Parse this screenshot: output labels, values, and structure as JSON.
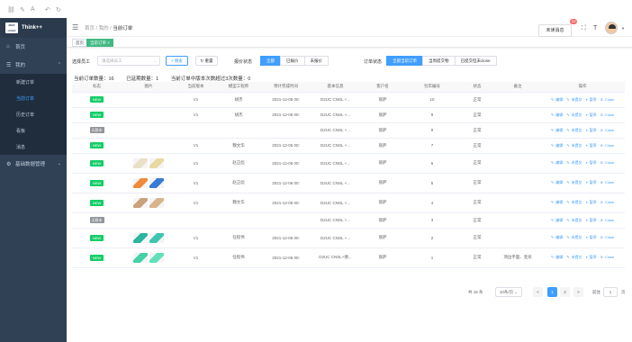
{
  "topbar_tools": [
    "⌀",
    "⌀",
    "⎌",
    "↻",
    "⚐"
  ],
  "sidebar": {
    "logo_mark": "MGR LOGO",
    "app_name": "Think++",
    "items": [
      {
        "label": "首页",
        "icon": "home-icon"
      },
      {
        "label": "我的",
        "icon": "user-icon",
        "expanded": true
      },
      {
        "label": "新建订单",
        "sub": true
      },
      {
        "label": "当前订单",
        "sub": true,
        "active": true
      },
      {
        "label": "历史订单",
        "sub": true
      },
      {
        "label": "看板",
        "sub": true
      },
      {
        "label": "消息",
        "sub": true
      },
      {
        "label": "基础数据管理",
        "icon": "gear-icon"
      }
    ]
  },
  "header": {
    "breadcrumb": [
      "首页",
      "我的",
      "当前订单"
    ],
    "msg_button": "未读消息",
    "msg_count": "20"
  },
  "tags": [
    "首页",
    "当前订单 ×"
  ],
  "filters": {
    "employee_label": "选择员工",
    "employee_placeholder": "请选择员工",
    "search_btn": "搜索",
    "reset_btn": "重置",
    "quote_label": "报价状态",
    "quote_options": [
      "全部",
      "已报价",
      "未报价"
    ],
    "order_label": "订单状态",
    "order_options": [
      "全部当前订单",
      "当周提交物",
      "已提交但未close"
    ]
  },
  "stats": {
    "current": "当前订单数量：16",
    "overdue": "已延期数量：1",
    "revised": "当前订单中版本次数超过3次数量：0"
  },
  "table": {
    "headers": [
      "标志",
      "图片",
      "当前版本",
      "模型工程师",
      "预计完成时间",
      "基本信息",
      "客户名",
      "包年编号",
      "状态",
      "备注",
      "操作"
    ],
    "rows": [
      {
        "flag": "NEW",
        "img": [],
        "ver": "V1",
        "eng": "胡杰",
        "date": "2021-12-06 00:",
        "info": "D2UC CNSL +...",
        "cust": "丽萨",
        "no": "10",
        "status": "正常",
        "note": ""
      },
      {
        "flag": "NEW",
        "img": [],
        "ver": "V1",
        "eng": "胡杰",
        "date": "2021-12-06 00:",
        "info": "D2UC CNSL +...",
        "cust": "丽萨",
        "no": "9",
        "status": "正常",
        "note": ""
      },
      {
        "flag": "无版本",
        "img": [],
        "ver": "",
        "eng": "",
        "date": "",
        "info": "D2UC CNSL +...",
        "cust": "丽萨",
        "no": "8",
        "status": "正常",
        "note": ""
      },
      {
        "flag": "NEW",
        "img": [],
        "ver": "V1",
        "eng": "魏文华",
        "date": "2021-12-06 00:",
        "info": "D2UC CNSL +...",
        "cust": "丽萨",
        "no": "7",
        "status": "正常",
        "note": ""
      },
      {
        "flag": "NEW",
        "img": [
          "#e8e1c6",
          "#e8d9a0"
        ],
        "ver": "V1",
        "eng": "赵正彪",
        "date": "2021-12-06 00:",
        "info": "D2UC CNSL +...",
        "cust": "丽萨",
        "no": "6",
        "status": "正常",
        "note": ""
      },
      {
        "flag": "NEW",
        "img": [
          "#f08a3c",
          "#3a7bd5"
        ],
        "ver": "V1",
        "eng": "赵正彪",
        "date": "2021-12-06 00:",
        "info": "D2UC CNSL +...",
        "cust": "丽萨",
        "no": "5",
        "status": "正常",
        "note": ""
      },
      {
        "flag": "NEW",
        "img": [
          "#c9a27a",
          "#d8b48c"
        ],
        "ver": "V1",
        "eng": "魏文华",
        "date": "2021-12-06 00:",
        "info": "D2UC CNSL +...",
        "cust": "丽萨",
        "no": "4",
        "status": "正常",
        "note": ""
      },
      {
        "flag": "无版本",
        "img": [],
        "ver": "",
        "eng": "",
        "date": "",
        "info": "D2UC CNSL +...",
        "cust": "丽萨",
        "no": "3",
        "status": "正常",
        "note": ""
      },
      {
        "flag": "NEW",
        "img": [
          "#2bb5a0",
          "#3fc6b0"
        ],
        "ver": "V1",
        "eng": "任程伟",
        "date": "2021-12-06 00:",
        "info": "D2UC CNSL +...",
        "cust": "丽萨",
        "no": "2",
        "status": "正常",
        "note": ""
      },
      {
        "flag": "NEW",
        "img": [
          "#43d1a8",
          "#5fe0bb"
        ],
        "ver": "V1",
        "eng": "任程伟",
        "date": "2021-12-06 00:",
        "info": "D2UC CNSL+德...",
        "cust": "丽萨",
        "no": "1",
        "status": "正常",
        "note": "顶边平面、变形"
      }
    ],
    "ops": [
      "编辑",
      "未提交",
      "暂停",
      "Close"
    ]
  },
  "pager": {
    "total": "共 16 条",
    "size": "10条/页",
    "pages": [
      "1",
      "2"
    ],
    "goto": "前往",
    "goto_value": "1",
    "goto_unit": "页",
    "prev": "<",
    "next": ">"
  },
  "colors": {
    "primary": "#409eff",
    "sidebar": "#304156",
    "new": "#13ce66"
  }
}
